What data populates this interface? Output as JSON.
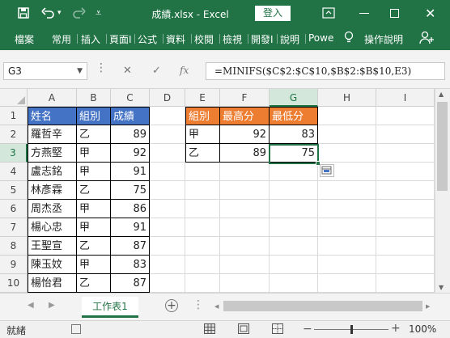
{
  "app": {
    "title": "成績.xlsx - Excel",
    "login": "登入"
  },
  "ribbon": {
    "tabs": [
      "檔案",
      "常用",
      "插入",
      "頁面I",
      "公式",
      "資料",
      "校閱",
      "檢視",
      "開發I",
      "說明",
      "Powe"
    ],
    "tell_me": "操作說明"
  },
  "formula_bar": {
    "name_box": "G3",
    "fx": "fx",
    "formula": "=MINIFS($C$2:$C$10,$B$2:$B$10,E3)"
  },
  "grid": {
    "columns": [
      "A",
      "B",
      "C",
      "D",
      "E",
      "F",
      "G",
      "H",
      "I"
    ],
    "rows": [
      "1",
      "2",
      "3",
      "4",
      "5",
      "6",
      "7",
      "8",
      "9",
      "10"
    ],
    "headers1": [
      "姓名",
      "組別",
      "成績"
    ],
    "records": [
      {
        "name": "羅哲辛",
        "group": "乙",
        "score": "89"
      },
      {
        "name": "方燕堅",
        "group": "甲",
        "score": "92"
      },
      {
        "name": "盧志銘",
        "group": "甲",
        "score": "91"
      },
      {
        "name": "林彥霖",
        "group": "乙",
        "score": "75"
      },
      {
        "name": "周杰丞",
        "group": "甲",
        "score": "86"
      },
      {
        "name": "楊心忠",
        "group": "甲",
        "score": "91"
      },
      {
        "name": "王聖宣",
        "group": "乙",
        "score": "87"
      },
      {
        "name": "陳玉妏",
        "group": "甲",
        "score": "83"
      },
      {
        "name": "楊怡君",
        "group": "乙",
        "score": "87"
      }
    ],
    "headers2": [
      "組別",
      "最高分",
      "最低分"
    ],
    "summary": [
      {
        "group": "甲",
        "max": "92",
        "min": "83"
      },
      {
        "group": "乙",
        "max": "89",
        "min": "75"
      }
    ]
  },
  "sheet_tab": "工作表1",
  "status": {
    "ready": "就緒",
    "zoom": "100%"
  },
  "colors": {
    "accent": "#217346",
    "blue_header": "#4472c4",
    "orange_header": "#ed7d31"
  }
}
